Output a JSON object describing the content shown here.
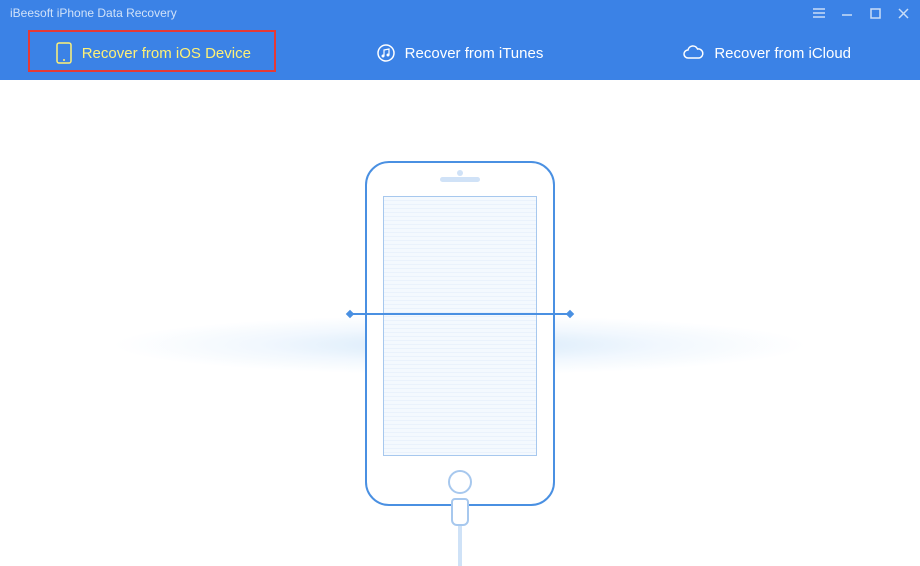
{
  "app": {
    "title": "iBeesoft iPhone Data Recovery"
  },
  "tabs": {
    "ios_device": "Recover from iOS Device",
    "itunes": "Recover from iTunes",
    "icloud": "Recover from iCloud"
  },
  "colors": {
    "primary": "#3b82e6",
    "highlight": "#e53935",
    "active_text": "#fff176"
  }
}
